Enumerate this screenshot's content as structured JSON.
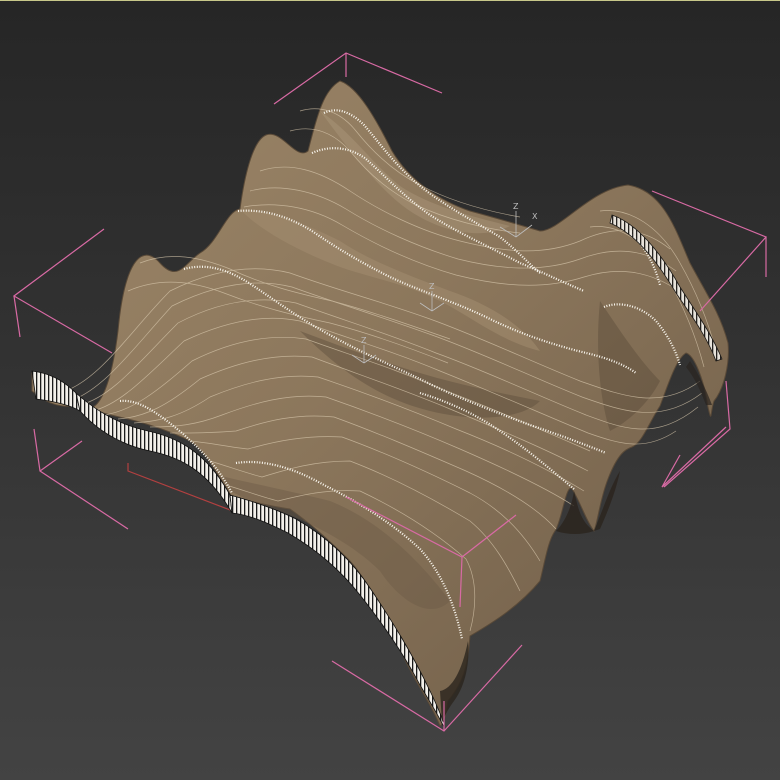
{
  "viewport": {
    "background_top": "#262626",
    "background_bottom": "#444444",
    "active_border_color": "#c8c88a"
  },
  "scene": {
    "object": "wavy-wood-contour-surface",
    "surface_color": "#8a765e",
    "surface_light_color": "#b19c80",
    "surface_shadow_color": "#4f4234",
    "contour_line_color": "#f2ece0",
    "selection_bracket_color": "#d86aa4",
    "grid_line_color": "#b24040"
  },
  "gizmos": [
    {
      "name": "pivot-gizmo-far",
      "axis_x": "X",
      "axis_z": "Z"
    },
    {
      "name": "pivot-gizmo-mid",
      "axis_x": "",
      "axis_z": "Z"
    },
    {
      "name": "pivot-gizmo-near",
      "axis_x": "",
      "axis_z": "Z"
    }
  ]
}
